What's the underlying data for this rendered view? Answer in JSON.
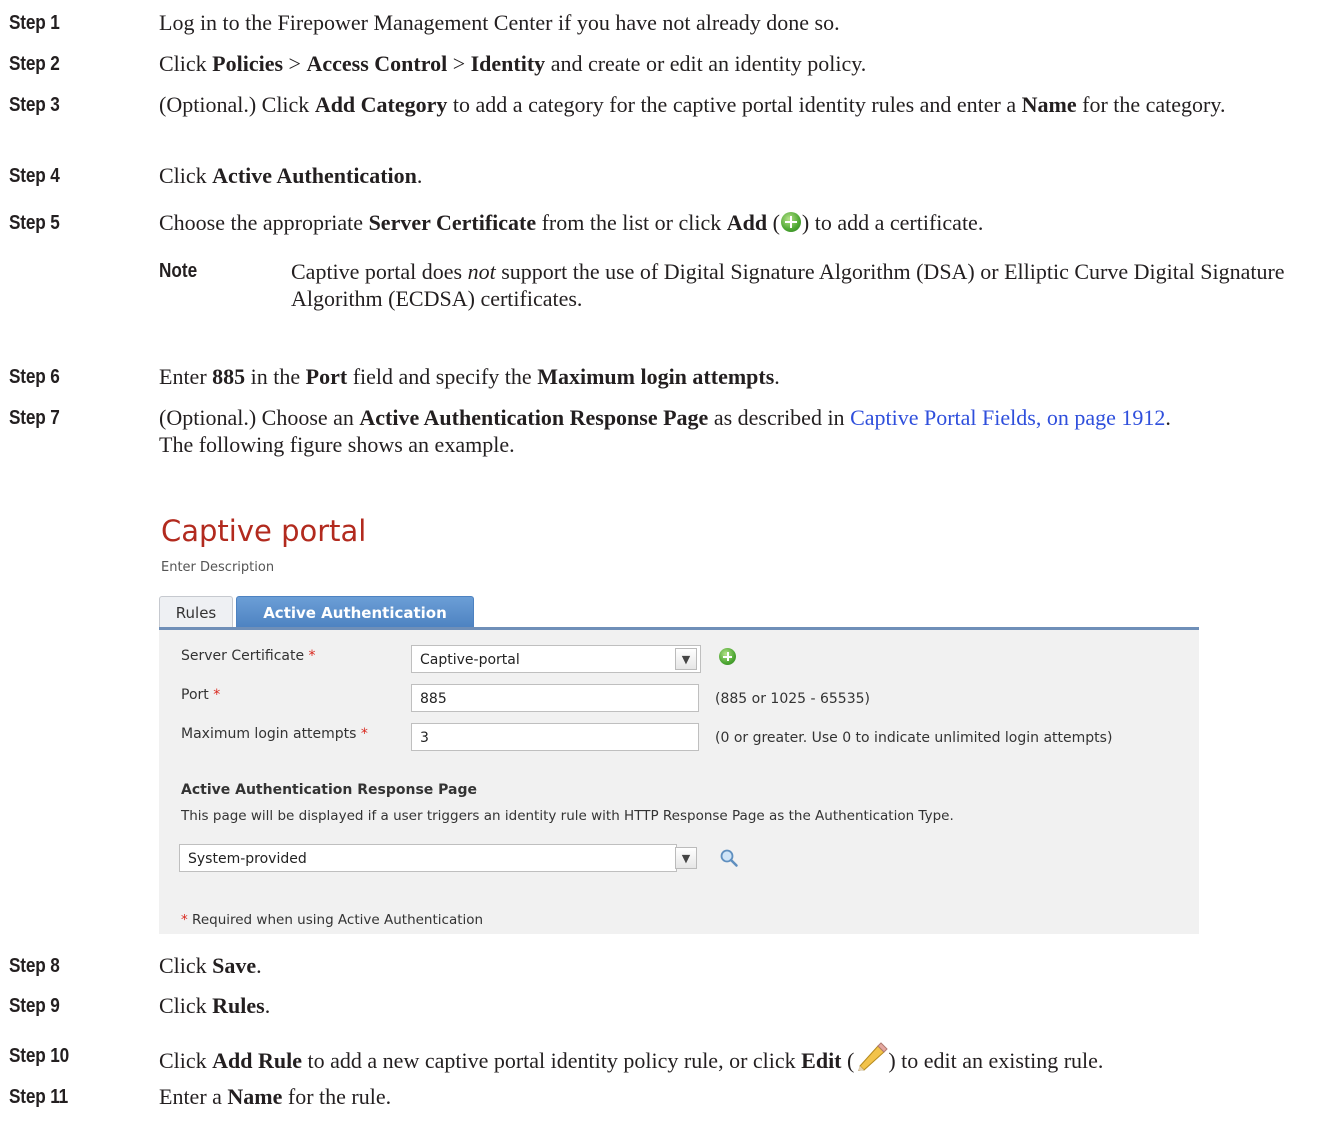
{
  "steps": {
    "s1": {
      "label": "Step 1",
      "text": "Log in to the Firepower Management Center if you have not already done so."
    },
    "s2": {
      "label": "Step 2",
      "a": "Click ",
      "b1": "Policies",
      "sep1": " > ",
      "b2": "Access Control",
      "sep2": " > ",
      "b3": "Identity",
      "c": " and create or edit an identity policy."
    },
    "s3": {
      "label": "Step 3",
      "a": "(Optional.) Click ",
      "b1": "Add Category",
      "c": " to add a category for the captive portal identity rules and enter a ",
      "b2": "Name",
      "d": " for the category."
    },
    "s4": {
      "label": "Step 4",
      "a": "Click ",
      "b1": "Active Authentication",
      "c": "."
    },
    "s5": {
      "label": "Step 5",
      "a": "Choose the appropriate ",
      "b1": "Server Certificate",
      "c": " from the list or click ",
      "b2": "Add",
      "d": " (",
      "e": ") to add a certificate."
    },
    "note": {
      "label": "Note",
      "a": "Captive portal does ",
      "i1": "not",
      "c": " support the use of Digital Signature Algorithm (DSA) or Elliptic Curve Digital Signature Algorithm (ECDSA) certificates."
    },
    "s6": {
      "label": "Step 6",
      "a": "Enter ",
      "b1": "885",
      "c": " in the ",
      "b2": "Port",
      "d": " field and specify the ",
      "b3": "Maximum login attempts",
      "e": "."
    },
    "s7": {
      "label": "Step 7",
      "a": "(Optional.) Choose an ",
      "b1": "Active Authentication Response Page",
      "c": " as described in ",
      "link": "Captive Portal Fields, on page 1912",
      "d": ".",
      "e": "The following figure shows an example."
    },
    "s8": {
      "label": "Step 8",
      "a": "Click ",
      "b1": "Save",
      "c": "."
    },
    "s9": {
      "label": "Step 9",
      "a": "Click ",
      "b1": "Rules",
      "c": "."
    },
    "s10": {
      "label": "Step 10",
      "a": "Click ",
      "b1": "Add Rule",
      "c": " to add a new captive portal identity policy rule, or click ",
      "b2": "Edit",
      "d": " (",
      "e": ") to edit an existing rule."
    },
    "s11": {
      "label": "Step 11",
      "a": "Enter a ",
      "b1": "Name",
      "c": " for the rule."
    }
  },
  "figure": {
    "title": "Captive portal",
    "description": "Enter Description",
    "tabs": {
      "rules": "Rules",
      "active": "Active Authentication"
    },
    "fields": {
      "server_certificate_label": "Server Certificate",
      "server_certificate_value": "Captive-portal",
      "port_label": "Port",
      "port_value": "885",
      "port_hint": "(885 or 1025 - 65535)",
      "max_login_label": "Maximum login attempts",
      "max_login_value": "3",
      "max_login_hint": "(0 or greater. Use 0 to indicate unlimited login attempts)",
      "required_mark": "*"
    },
    "response_page": {
      "title": "Active Authentication Response Page",
      "description": "This page will be displayed if a user triggers an identity rule with HTTP Response Page as the Authentication Type.",
      "value": "System-provided"
    },
    "footnote": "Required when using Active Authentication",
    "colors": {
      "title": "#b22a1e",
      "tab_active": "#5a8dcb",
      "required": "#d9271d",
      "link": "#2f4fdc"
    }
  }
}
